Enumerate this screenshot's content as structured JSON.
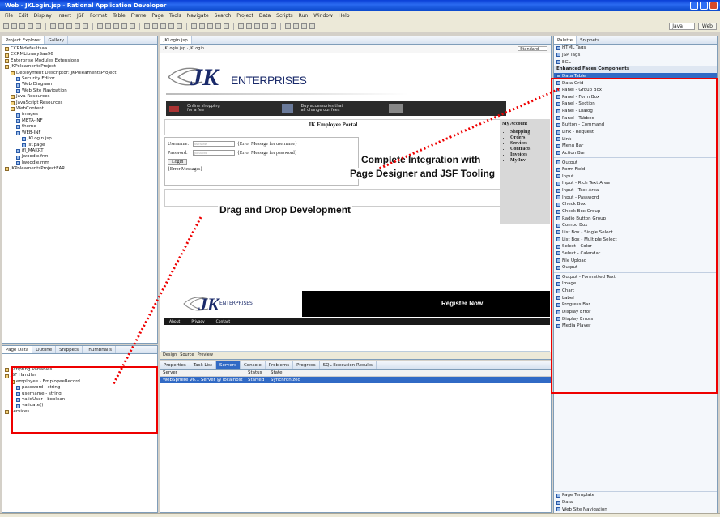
{
  "window": {
    "title": "Web - JKLogin.jsp - Rational Application Developer"
  },
  "menu": [
    "File",
    "Edit",
    "Display",
    "Insert",
    "JSF",
    "Format",
    "Table",
    "Frame",
    "Page",
    "Tools",
    "Navigate",
    "Search",
    "Project",
    "Data",
    "Scripts",
    "Run",
    "Window",
    "Help"
  ],
  "perspective": {
    "quick_access": "Java",
    "web": "Web"
  },
  "project_explorer": {
    "tabs": [
      "Project Explorer",
      "Gallery"
    ],
    "items": [
      {
        "label": "CCRMdefaultsaa",
        "indent": 0
      },
      {
        "label": "CCRMLibrarySaa96",
        "indent": 0
      },
      {
        "label": "Enterprise Modules Extensions",
        "indent": 0
      },
      {
        "label": "JKPoleamentsProject",
        "indent": 0
      },
      {
        "label": "Deployment Descriptor: JKPoleamentsProject",
        "indent": 1
      },
      {
        "label": "Security Editor",
        "indent": 2
      },
      {
        "label": "Web Diagram",
        "indent": 2
      },
      {
        "label": "Web Site Navigation",
        "indent": 2
      },
      {
        "label": "Java Resources",
        "indent": 1
      },
      {
        "label": "JavaScript Resources",
        "indent": 1
      },
      {
        "label": "WebContent",
        "indent": 1
      },
      {
        "label": "images",
        "indent": 2
      },
      {
        "label": "META-INF",
        "indent": 2
      },
      {
        "label": "theme",
        "indent": 2
      },
      {
        "label": "WEB-INF",
        "indent": 2
      },
      {
        "label": "JKLogin.jsp",
        "indent": 3
      },
      {
        "label": "jsf.page",
        "indent": 3
      },
      {
        "label": "ifl_MAKRT",
        "indent": 2
      },
      {
        "label": "Jwoodle.frm",
        "indent": 2
      },
      {
        "label": "Jwoodle.mm",
        "indent": 2
      },
      {
        "label": "JKPoleamentsProjectEAR",
        "indent": 0
      }
    ]
  },
  "page_data": {
    "tabs": [
      "Page Data",
      "Outline",
      "Snippets",
      "Thumbnails"
    ],
    "items": [
      {
        "label": "Scripting Variables",
        "indent": 0
      },
      {
        "label": "JSF Handler",
        "indent": 0
      },
      {
        "label": "employee - EmployeeRecord",
        "indent": 1
      },
      {
        "label": "password - string",
        "indent": 2
      },
      {
        "label": "username - string",
        "indent": 2
      },
      {
        "label": "validUser - boolean",
        "indent": 2
      },
      {
        "label": "validate()",
        "indent": 2
      },
      {
        "label": "Services",
        "indent": 0
      }
    ]
  },
  "editor": {
    "tab": "JKLogin.jsp",
    "breadcrumb": "JKLogin.jsp · JKLogin",
    "style_label": "Standard",
    "logo_text": "ENTERPRISES",
    "banner_left": "Online shopping\nfor a fee",
    "banner_mid": "Buy accessories that\nall change our fees",
    "portal_title": "JK Employee Portal",
    "username_label": "Username:",
    "password_label": "Password:",
    "username_field": "username",
    "password_field": "password",
    "username_error": "{Error Message for username}",
    "password_error": "{Error Message for password}",
    "login_button": "Login",
    "error_messages": "{Error Messages}",
    "my_account": "My Account",
    "account_items": [
      "Shopping",
      "Orders",
      "Services",
      "Contracts",
      "Invoices",
      "My Inv"
    ],
    "footer_logo_text": "ENTERPRISES",
    "register": "Register Now!",
    "footer_nav": [
      "About",
      "Privacy",
      "Contact"
    ],
    "mode_tabs": [
      "Design",
      "Source",
      "Preview"
    ]
  },
  "bottom": {
    "tabs": [
      "Properties",
      "Task List",
      "Servers",
      "Console",
      "Problems",
      "Progress",
      "SQL Execution Results"
    ],
    "active_tab": "Servers",
    "columns": [
      "Server",
      "Status",
      "State"
    ],
    "rows": [
      {
        "server": "WebSphere v6.1 Server @ localhost",
        "status": "Started",
        "state": "Synchronized"
      }
    ]
  },
  "palette": {
    "tabs": [
      "Palette",
      "Snippets"
    ],
    "top_items": [
      "HTML Tags",
      "JSP Tags",
      "EGL"
    ],
    "section": "Enhanced Faces Components",
    "items": [
      "Data Table",
      "Data Grid",
      "Panel - Group Box",
      "Panel - Form Box",
      "Panel - Section",
      "Panel - Dialog",
      "Panel - Tabbed",
      "Button - Command",
      "Link - Request",
      "Link",
      "Menu Bar",
      "Action Bar",
      "Output",
      "Form Field",
      "Input",
      "Input - Rich Text Area",
      "Input - Text Area",
      "Input - Password",
      "Check Box",
      "Check Box Group",
      "Radio Button Group",
      "Combo Box",
      "List Box - Single Select",
      "List Box - Multiple Select",
      "Select - Color",
      "Select - Calendar",
      "File Upload",
      "Output",
      "Output - Formatted Text",
      "Image",
      "Chart",
      "Label",
      "Progress Bar",
      "Display Error",
      "Display Errors",
      "Media Player"
    ],
    "bottom_items": [
      "Page Template",
      "Data",
      "Web Site Navigation"
    ]
  },
  "callouts": {
    "integration_1": "Complete Integration with",
    "integration_2": "Page Designer and JSF Tooling",
    "dnd": "Drag and Drop Development"
  },
  "colors": {
    "highlight": "#e00000",
    "title_bar": "#0a3fd6",
    "palette_selected": "#316ac5"
  }
}
